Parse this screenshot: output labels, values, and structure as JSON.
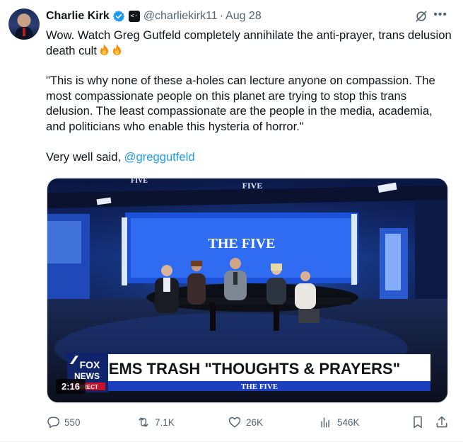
{
  "tweet": {
    "author_name": "Charlie Kirk",
    "handle": "@charliekirk11",
    "separator": "·",
    "date": "Aug 28",
    "text_line1": "Wow. Watch Greg Gutfeld completely annihilate the anti-prayer, trans delusion death cult",
    "quote": "\"This is why none of these a-holes can lecture anyone on compassion. The most compassionate people on this planet are trying to stop this trans delusion. The least compassionate are the people in the media, academia, and politicians who enable this hysteria of horror.\"",
    "closing_text": "Very well said, ",
    "mention": "@greggutfeld"
  },
  "media": {
    "show_logo": "THE FIVE",
    "screen_label": "FIVE",
    "lower_third_headline": "DEMS TRASH \"THOUGHTS & PRAYERS\"",
    "lower_third_show": "THE FIVE",
    "network_line1": "FOX",
    "network_line2": "NEWS",
    "network_line3": "DIRECT",
    "duration": "2:16"
  },
  "actions": {
    "replies": "550",
    "reposts": "7.1K",
    "likes": "26K",
    "views": "546K"
  },
  "colors": {
    "accent": "#1d9bf0",
    "text": "#0f1419",
    "muted": "#536471"
  }
}
